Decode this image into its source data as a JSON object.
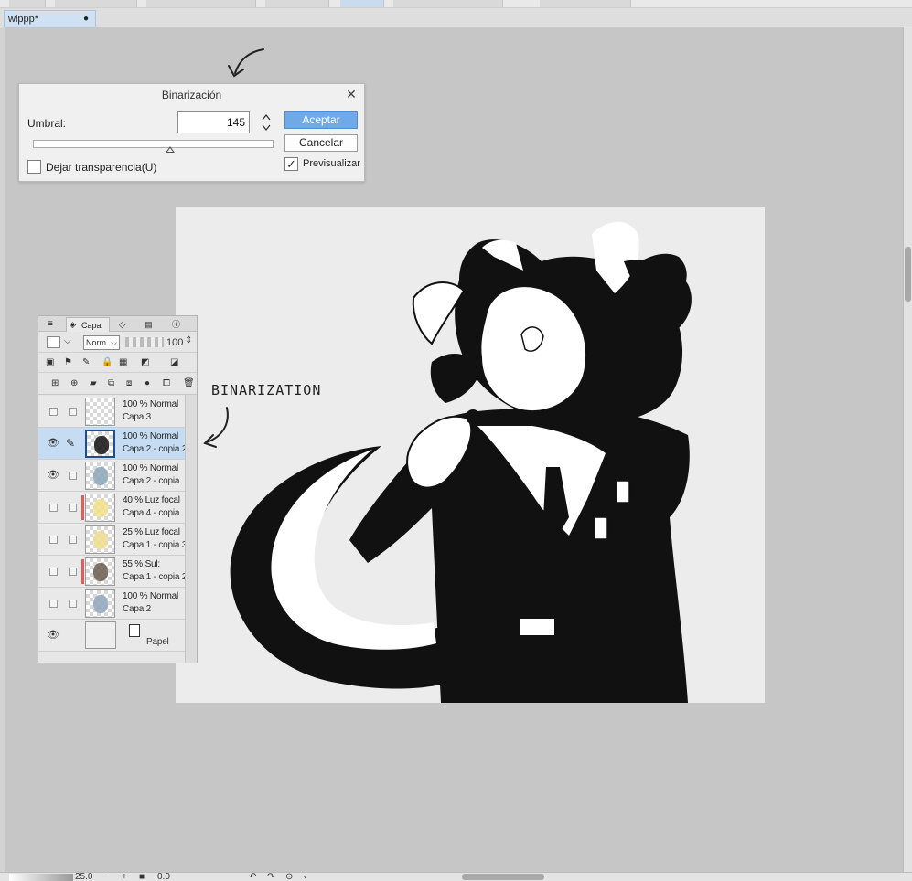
{
  "document_tab": {
    "name": "wippp*",
    "modified_dot": "●"
  },
  "dialog": {
    "title": "Binarización",
    "close": "✕",
    "threshold_label": "Umbral:",
    "threshold_value": "145",
    "threshold_fraction": 0.57,
    "ok_label": "Aceptar",
    "cancel_label": "Cancelar",
    "keep_transparency_label": "Dejar transparencia(U)",
    "keep_transparency_checked": false,
    "preview_label": "Previsualizar",
    "preview_checked": true,
    "check_mark": "✓"
  },
  "annotation": {
    "text": "BINARIZATION"
  },
  "layer_panel": {
    "tab_label": "Capa",
    "blend_mode": "Norm",
    "opacity": "100",
    "layers": [
      {
        "mode": "100 % Normal",
        "name": "Capa 3",
        "visible": false,
        "selected": false,
        "tag": false
      },
      {
        "mode": "100 % Normal",
        "name": "Capa 2 - copia 2",
        "visible": true,
        "selected": true,
        "tag": false
      },
      {
        "mode": "100 % Normal",
        "name": "Capa 2 - copia",
        "visible": true,
        "selected": false,
        "tag": false
      },
      {
        "mode": "40 % Luz focal",
        "name": "Capa 4 - copia",
        "visible": false,
        "selected": false,
        "tag": true
      },
      {
        "mode": "25 % Luz focal",
        "name": "Capa 1 - copia 3",
        "visible": false,
        "selected": false,
        "tag": false
      },
      {
        "mode": "55 % Sul:",
        "name": "Capa 1 - copia 2",
        "visible": false,
        "selected": false,
        "tag": true
      },
      {
        "mode": "100 % Normal",
        "name": "Capa 2",
        "visible": false,
        "selected": false,
        "tag": false
      }
    ],
    "paper": {
      "name": "Papel",
      "visible": true
    }
  },
  "status_bar": {
    "zoom": "25.0",
    "rotation": "0.0",
    "minus": "−",
    "plus": "+"
  },
  "colors": {
    "accent": "#6fa9e8",
    "selected_layer": "#c5dcf2",
    "canvas_bg": "#ececec",
    "workspace": "#c6c6c6"
  }
}
